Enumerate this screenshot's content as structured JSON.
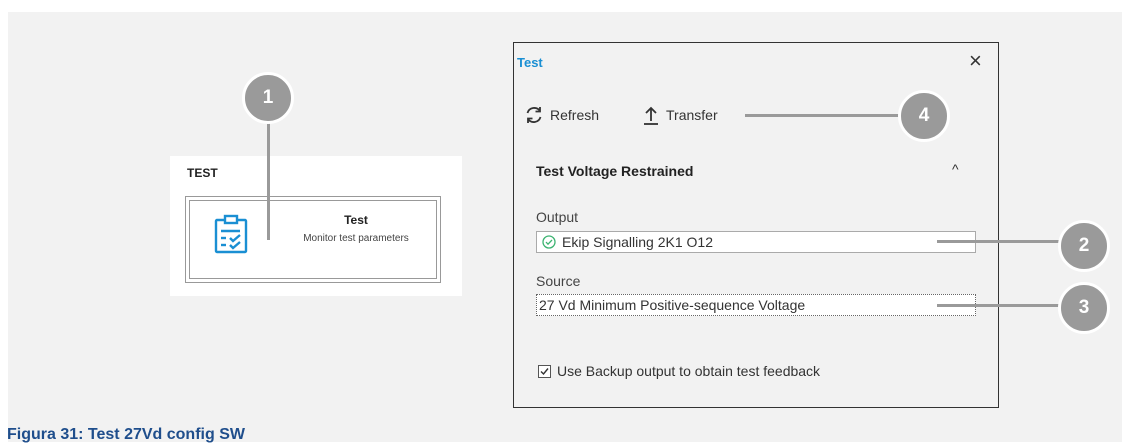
{
  "left_card": {
    "section_title": "TEST",
    "tile_name": "Test",
    "tile_desc": "Monitor test parameters"
  },
  "callouts": [
    "1",
    "2",
    "3",
    "4"
  ],
  "dialog": {
    "title": "Test",
    "close_glyph": "×",
    "toolbar": {
      "refresh_label": "Refresh",
      "transfer_label": "Transfer"
    },
    "section_title": "Test Voltage Restrained",
    "chevron_glyph": "^",
    "output_label": "Output",
    "output_value": "Ekip Signalling 2K1 O12",
    "source_label": "Source",
    "source_value": "27 Vd Minimum Positive-sequence Voltage",
    "backup_label": "Use Backup output to obtain test feedback",
    "backup_checked": true
  },
  "caption": "Figura 31: Test 27Vd config SW",
  "colors": {
    "accent": "#1a8fd3",
    "callout": "#9a9a9a",
    "caption": "#1f4e8c",
    "ok": "#3cb371"
  },
  "icons": [
    "clipboard-check-icon",
    "refresh-icon",
    "upload-arrow-icon",
    "close-icon",
    "chevron-up-icon",
    "check-circle-icon",
    "checkmark-icon"
  ]
}
